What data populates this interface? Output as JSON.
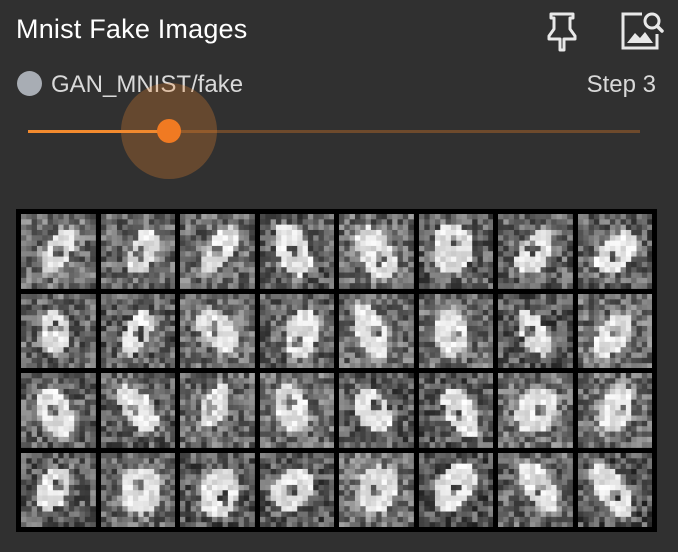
{
  "card": {
    "title": "Mnist Fake Images",
    "run_name": "GAN_MNIST/fake",
    "step_label": "Step 3",
    "pin_icon": "pin-icon",
    "expand_icon": "image-search-icon"
  },
  "slider": {
    "value_fraction": 0.23,
    "accent_color": "#f07a22",
    "track_color": "#6e4a2c"
  },
  "run": {
    "color": "#a8adb4"
  },
  "image_grid": {
    "rows": 4,
    "cols": 8,
    "description_icon": "generated-digit-image"
  }
}
